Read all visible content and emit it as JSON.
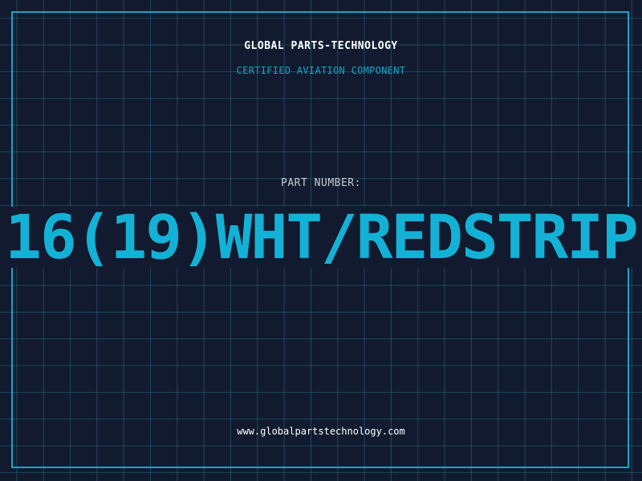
{
  "card": {
    "company_name": "GLOBAL PARTS-TECHNOLOGY",
    "certification": "CERTIFIED AVIATION COMPONENT",
    "part_number_label": "PART NUMBER:",
    "part_number": "16(19)WHT/REDSTRIP",
    "website": "www.globalpartstechnology.com"
  },
  "colors": {
    "background": "#111a2e",
    "accent": "#14b1d6",
    "grid": "#286e87",
    "text": "#ffffff"
  }
}
